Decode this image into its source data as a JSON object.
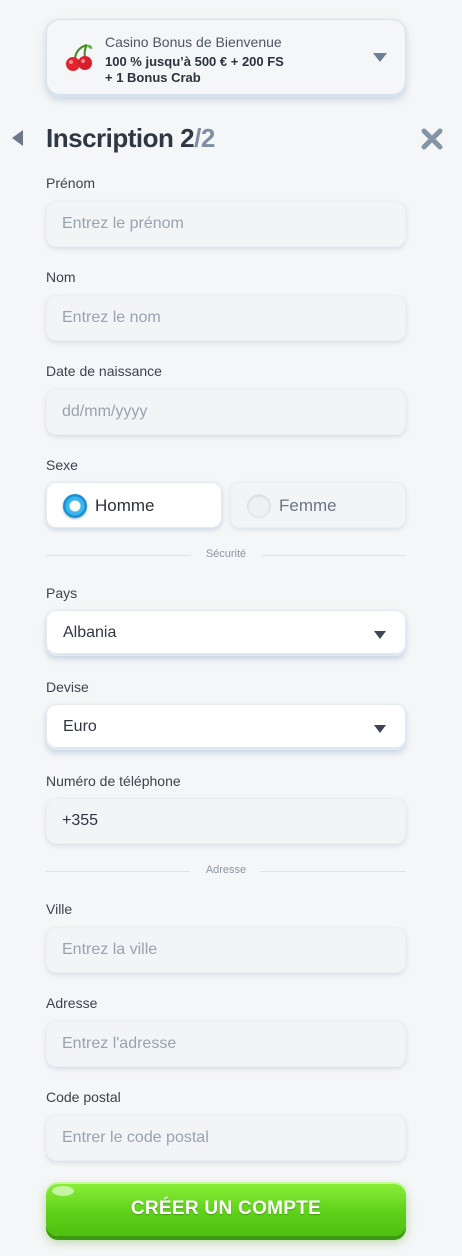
{
  "bonus": {
    "title": "Casino Bonus de Bienvenue",
    "line1": "100 % jusqu’à 500 € + 200 FS",
    "line2": "+ 1 Bonus Crab",
    "icon": "cherry-icon"
  },
  "header": {
    "title_prefix": "Inscription 2",
    "title_sep": "/",
    "title_total": "2",
    "back_icon": "back-arrow-icon",
    "close_icon": "close-icon"
  },
  "form": {
    "first_name": {
      "label": "Prénom",
      "placeholder": "Entrez le prénom",
      "value": ""
    },
    "last_name": {
      "label": "Nom",
      "placeholder": "Entrez le nom",
      "value": ""
    },
    "birth_date": {
      "label": "Date de naissance",
      "placeholder": "dd/mm/yyyy",
      "value": ""
    },
    "gender": {
      "label": "Sexe",
      "options": [
        {
          "label": "Homme",
          "selected": true
        },
        {
          "label": "Femme",
          "selected": false
        }
      ]
    },
    "security_divider": "Sécurité",
    "country": {
      "label": "Pays",
      "value": "Albania"
    },
    "currency": {
      "label": "Devise",
      "value": "Euro"
    },
    "phone": {
      "label": "Numéro de téléphone",
      "value": "+355"
    },
    "address_divider": "Adresse",
    "city": {
      "label": "Ville",
      "placeholder": "Entrez la ville",
      "value": ""
    },
    "address": {
      "label": "Adresse",
      "placeholder": "Entrez l'adresse",
      "value": ""
    },
    "postal_code": {
      "label": "Code postal",
      "placeholder": "Entrer le code postal",
      "value": ""
    }
  },
  "submit": {
    "label": "CRÉER UN COMPTE"
  },
  "colors": {
    "accent_green": "#5fd11a",
    "radio_blue": "#1a8fd0",
    "background": "#f5f6f7",
    "muted_title": "#7d8fa4"
  }
}
